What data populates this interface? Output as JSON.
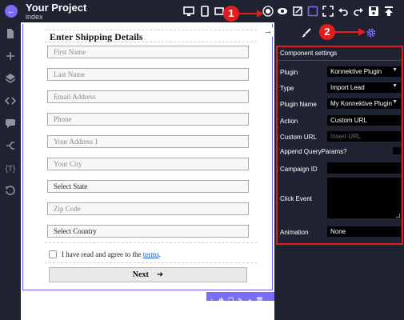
{
  "project": {
    "title": "Your Project",
    "page": "index"
  },
  "annotations": {
    "badge_1": "1",
    "badge_2": "2"
  },
  "form": {
    "title": "Enter Shipping Details",
    "fields": [
      {
        "placeholder": "First Name"
      },
      {
        "placeholder": "Last Name"
      },
      {
        "placeholder": "Email Address"
      },
      {
        "placeholder": "Phone"
      },
      {
        "placeholder": "Your Address 1"
      },
      {
        "placeholder": "Your City"
      },
      {
        "placeholder": "Select State"
      },
      {
        "placeholder": "Zip Code"
      },
      {
        "placeholder": "Select Country"
      }
    ],
    "agree_text": "I have read and agree to the",
    "terms_link": "terms",
    "terms_suffix": ".",
    "next_label": "Next"
  },
  "settings": {
    "heading": "Component settings",
    "plugin_label": "Plugin",
    "plugin_value": "Konnektive Plugin",
    "type_label": "Type",
    "type_value": "Import Lead",
    "plugin_name_label": "Plugin Name",
    "plugin_name_value": "My Konnektive Plugin",
    "action_label": "Action",
    "action_value": "Custom URL",
    "custom_url_label": "Custom URL",
    "custom_url_placeholder": "Insert URL",
    "append_label": "Append QueryParams?",
    "campaign_label": "Campaign ID",
    "campaign_value": "",
    "click_event_label": "Click Event",
    "animation_label": "Animation",
    "animation_value": "None"
  },
  "colors": {
    "accent": "#7b6cf6",
    "annotation_red": "#e11d1d",
    "panel_bg": "#1f2230"
  }
}
